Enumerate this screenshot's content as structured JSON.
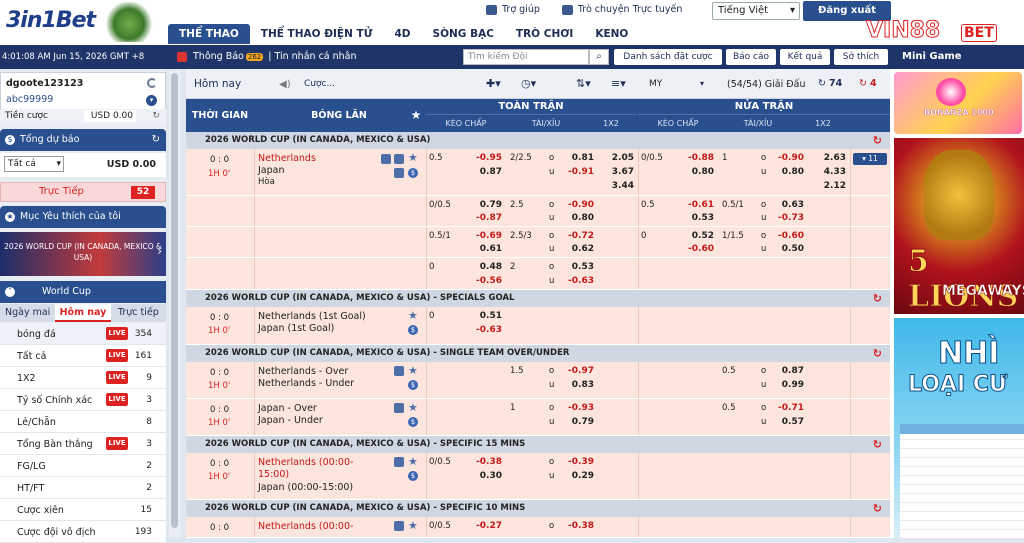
{
  "brand": {
    "logo_text": "3in1Bet",
    "ad_brand": "VIN88",
    "ad_suffix": "BET"
  },
  "nav": [
    "THỂ THAO",
    "THỂ THAO ĐIỆN TỬ",
    "4D",
    "SÒNG BẠC",
    "TRÒ CHƠI",
    "KENO"
  ],
  "top_links": {
    "help": "Trợ giúp",
    "chat": "Trò chuyện Trực tuyến",
    "language": "Tiếng Việt",
    "logout": "Đăng xuất"
  },
  "subbar": {
    "clock": "4:01:08 AM Jun 15, 2026 GMT +8",
    "notice": "Thông Báo",
    "notice_badge": "262",
    "messages": "Tin nhắn cá nhân",
    "search_placeholder": "Tìm kiếm Đội",
    "bet_list": "Danh sách đặt cược",
    "report": "Báo cáo",
    "results": "Kết quả",
    "favorites": "Sở thích",
    "mini_game": "Mini Game"
  },
  "account": {
    "username": "dgoote123123",
    "alias": "abc99999",
    "credit_label": "Tiền cược",
    "credit_value": "USD 0.00"
  },
  "summary": {
    "title": "Tổng dự báo",
    "filter": "Tất cả",
    "value": "USD 0.00"
  },
  "live": {
    "label": "Trực Tiếp",
    "count": "52"
  },
  "favorites": {
    "title": "Mục Yêu thích của tôi"
  },
  "banner_text": "2026 WORLD CUP (IN CANADA, MEXICO & USA)",
  "worldcup": {
    "title": "World Cup",
    "tabs": [
      "Ngày mai",
      "Hôm nay",
      "Trực tiếp"
    ]
  },
  "left_rows": [
    {
      "label": "bóng đá",
      "live": "LIVE",
      "count": "354"
    },
    {
      "label": "Tất cả",
      "live": "LIVE",
      "count": "161"
    },
    {
      "label": "1X2",
      "live": "LIVE",
      "count": "9"
    },
    {
      "label": "Tỷ số Chính xác",
      "live": "LIVE",
      "count": "3"
    },
    {
      "label": "Lẻ/Chẵn",
      "live": "",
      "count": "8"
    },
    {
      "label": "Tổng Bàn thắng",
      "live": "LIVE",
      "count": "3"
    },
    {
      "label": "FG/LG",
      "live": "",
      "count": "2"
    },
    {
      "label": "HT/FT",
      "live": "",
      "count": "2"
    },
    {
      "label": "Cược xiên",
      "live": "",
      "count": "15"
    },
    {
      "label": "Cược đội vô địch",
      "live": "",
      "count": "193"
    }
  ],
  "toolbar": {
    "today": "Hôm nay",
    "bet_label": "Cược...",
    "odds_type": "MY",
    "count": "(54/54) Giải Đấu",
    "refresh1": "74",
    "refresh2": "4"
  },
  "table_header": {
    "time": "THỜI GIAN",
    "match": "BÓNG LĂN",
    "full": "TOÀN TRẬN",
    "half": "NỬA TRẬN",
    "sub": [
      "KÈO CHẤP",
      "TÀI/XỈU",
      "1X2",
      "KÈO CHẤP",
      "TÀI/XỈU",
      "1X2"
    ]
  },
  "leagues": [
    {
      "title": "2026 WORLD CUP (IN CANADA, MEXICO & USA)"
    },
    {
      "title": "2026 WORLD CUP (IN CANADA, MEXICO & USA) - SPECIALS GOAL"
    },
    {
      "title": "2026 WORLD CUP (IN CANADA, MEXICO & USA) - SINGLE TEAM OVER/UNDER"
    },
    {
      "title": "2026 WORLD CUP (IN CANADA, MEXICO & USA) - SPECIFIC 15 MINS"
    },
    {
      "title": "2026 WORLD CUP (IN CANADA, MEXICO & USA) - SPECIFIC 10 MINS"
    }
  ],
  "match1": {
    "score": "0 : 0",
    "period": "1H 0'",
    "home": "Netherlands",
    "away": "Japan",
    "draw": "Hòa",
    "more": "▾ 11",
    "lines": [
      {
        "fh": "0.5",
        "fho": "-0.95",
        "fha": "0.87",
        "fou": "2/2.5",
        "fouo": "0.81",
        "foua": "-0.91",
        "f1": "2.05",
        "f2": "3.67",
        "f3": "3.44",
        "hh": "0/0.5",
        "hho": "-0.88",
        "hha": "0.80",
        "hou": "1",
        "houo": "-0.90",
        "houa": "0.80",
        "h1": "2.63",
        "h2": "4.33",
        "h3": "2.12"
      },
      {
        "fh": "0/0.5",
        "fho": "0.79",
        "fha": "-0.87",
        "fou": "2.5",
        "fouo": "-0.90",
        "foua": "0.80",
        "hh": "0.5",
        "hho": "-0.61",
        "hha": "0.53",
        "hou": "0.5/1",
        "houo": "0.63",
        "houa": "-0.73"
      },
      {
        "fh": "0.5/1",
        "fho": "-0.69",
        "fha": "0.61",
        "fou": "2.5/3",
        "fouo": "-0.72",
        "foua": "0.62",
        "hh": "0",
        "hho": "0.52",
        "hha": "-0.60",
        "hou": "1/1.5",
        "houo": "-0.60",
        "houa": "0.50"
      },
      {
        "fh": "0",
        "fho": "0.48",
        "fha": "-0.56",
        "fou": "2",
        "fouo": "0.53",
        "foua": "-0.63"
      }
    ]
  },
  "match2": {
    "score": "0 : 0",
    "period": "1H 0'",
    "home": "Netherlands (1st Goal)",
    "away": "Japan (1st Goal)",
    "fh": "0",
    "fho": "0.51",
    "fha": "-0.63"
  },
  "match3": [
    {
      "score": "0 : 0",
      "period": "1H 0'",
      "home": "Netherlands - Over",
      "away": "Netherlands - Under",
      "fou": "1.5",
      "fouo": "-0.97",
      "foua": "0.83",
      "hou": "0.5",
      "houo": "0.87",
      "houa": "0.99"
    },
    {
      "score": "0 : 0",
      "period": "1H 0'",
      "home": "Japan - Over",
      "away": "Japan - Under",
      "fou": "1",
      "fouo": "-0.93",
      "foua": "0.79",
      "hou": "0.5",
      "houo": "-0.71",
      "houa": "0.57"
    }
  ],
  "match4": {
    "score": "0 : 0",
    "period": "1H 0'",
    "home1": "Netherlands (00:00-",
    "home2": "15:00)",
    "away": "Japan (00:00-15:00)",
    "fh": "0/0.5",
    "fho": "-0.38",
    "fha": "0.30",
    "fouo": "-0.39",
    "foua": "0.29"
  },
  "match5": {
    "score": "0 : 0",
    "period": "1H 0'",
    "home1": "Netherlands (00:00-",
    "home2": "10:00)",
    "fh": "0/0.5",
    "fho": "-0.27",
    "fouo": "-0.38"
  },
  "ads": {
    "ad1": "BONANZA 1000",
    "ad2_title": "5 LIONS",
    "ad2_sub": "MEGAWAYS",
    "ad3_t1": "NHÌ",
    "ad3_t2": "LOẠI CƯ"
  },
  "icons": [
    "refresh-icon",
    "chevron-down-icon",
    "chart-icon",
    "dollar-icon",
    "tv-icon",
    "star-icon",
    "speaker-icon",
    "calendar-icon",
    "search-icon",
    "plus-icon",
    "clock-icon",
    "sort-icon",
    "list-icon"
  ]
}
